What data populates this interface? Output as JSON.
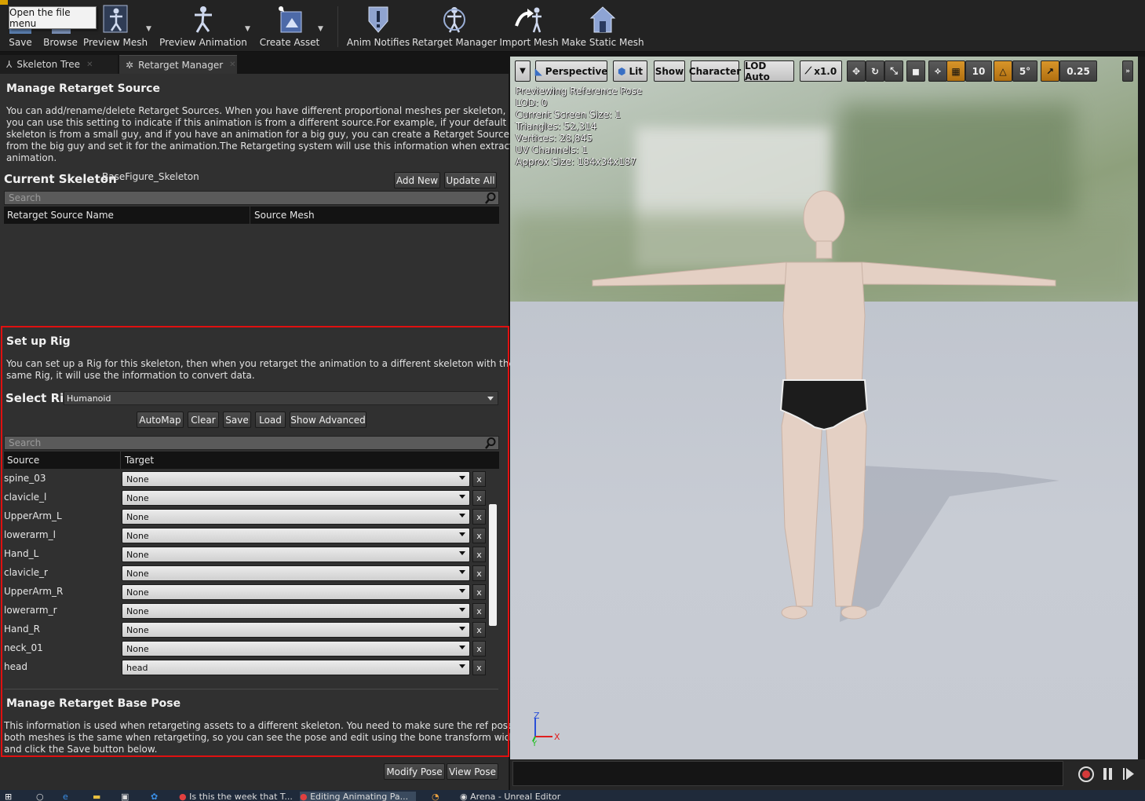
{
  "tooltip": "Open the file menu",
  "toolbar": {
    "save": "Save",
    "browse": "Browse",
    "preview_mesh": "Preview Mesh",
    "preview_animation": "Preview Animation",
    "create_asset": "Create Asset",
    "anim_notifies": "Anim Notifies",
    "retarget_manager": "Retarget Manager",
    "import_mesh": "Import Mesh",
    "make_static_mesh": "Make Static Mesh"
  },
  "tabs": {
    "skeleton_tree": "Skeleton Tree",
    "retarget_manager": "Retarget Manager"
  },
  "retarget_source": {
    "title": "Manage Retarget Source",
    "description": [
      "You can add/rename/delete Retarget Sources. When you have different proportional meshes per skeleton,",
      "you can use this setting to indicate if this animation is from a different source.For example, if your default",
      "skeleton is from a small guy, and if you have an animation for a big guy, you can create a Retarget Source",
      "from the big guy and set it for the animation.The Retargeting system will use this information when extracting",
      "animation."
    ],
    "current_skeleton_label": "Current Skeleton",
    "current_skeleton_value": "BaseFigure_Skeleton",
    "add_new": "Add New",
    "update_all": "Update All",
    "search_placeholder": "Search",
    "col_name": "Retarget Source Name",
    "col_mesh": "Source Mesh"
  },
  "rig": {
    "title": "Set up Rig",
    "description": [
      "You can set up a Rig for this skeleton, then when you retarget the animation to a different skeleton with the",
      "same Rig, it will use the information to convert data."
    ],
    "select_rig_label": "Select Rig",
    "selected_rig": "Humanoid",
    "automap": "AutoMap",
    "clear": "Clear",
    "save": "Save",
    "load": "Load",
    "show_advanced": "Show Advanced",
    "search_placeholder": "Search",
    "col_source": "Source",
    "col_target": "Target",
    "rows": [
      {
        "source": "spine_03",
        "target": "None"
      },
      {
        "source": "clavicle_l",
        "target": "None"
      },
      {
        "source": "UpperArm_L",
        "target": "None"
      },
      {
        "source": "lowerarm_l",
        "target": "None"
      },
      {
        "source": "Hand_L",
        "target": "None"
      },
      {
        "source": "clavicle_r",
        "target": "None"
      },
      {
        "source": "UpperArm_R",
        "target": "None"
      },
      {
        "source": "lowerarm_r",
        "target": "None"
      },
      {
        "source": "Hand_R",
        "target": "None"
      },
      {
        "source": "neck_01",
        "target": "None"
      },
      {
        "source": "head",
        "target": "head"
      }
    ],
    "clear_row": "x"
  },
  "base_pose": {
    "title": "Manage Retarget Base Pose",
    "description": [
      "This information is used when retargeting assets to a different skeleton. You need to make sure the ref pose of",
      "both meshes is the same when retargeting, so you can see the pose and edit using the bone transform widget,",
      "and click the Save button below."
    ],
    "modify_pose": "Modify Pose",
    "view_pose": "View Pose"
  },
  "viewport": {
    "perspective": "Perspective",
    "lit": "Lit",
    "show": "Show",
    "character": "Character",
    "lod": "LOD Auto",
    "speed": "x1.0",
    "grid_snap": "10",
    "rot_snap": "5°",
    "scale_snap": "0.25",
    "stats": [
      "Previewing Reference Pose",
      "LOD: 0",
      "Current Screen Size: 1",
      "Triangles: 52,314",
      "Vertices: 28,845",
      "UV Channels: 1",
      "Approx Size: 184x34x187"
    ],
    "axis_z": "Z",
    "axis_x": "X",
    "axis_y": "Y"
  },
  "taskbar": {
    "item1": "Is this the week that T...",
    "item2": "Editing Animating Pa...",
    "item3": "Arena - Unreal Editor"
  },
  "colors": {
    "highlight_box": "#e01010",
    "orange_toggle": "#c98420"
  }
}
